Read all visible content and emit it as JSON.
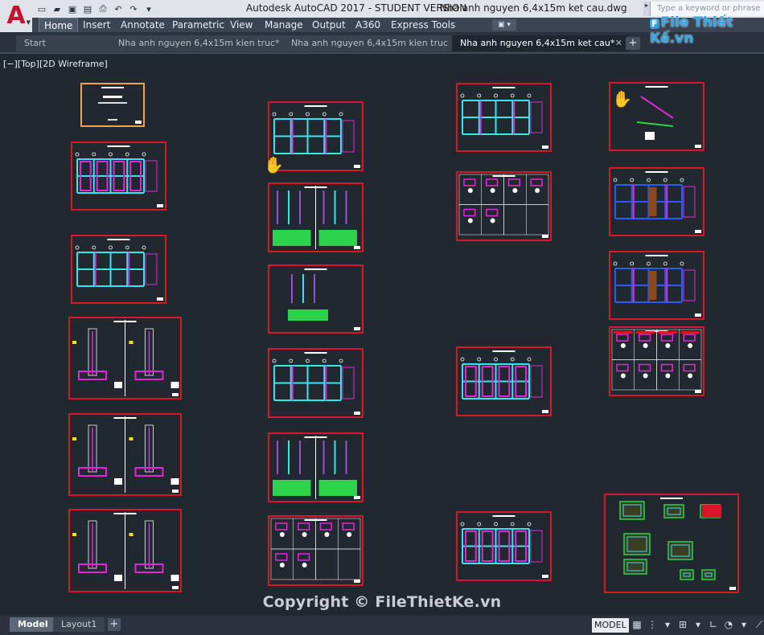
{
  "app": {
    "title": "Autodesk AutoCAD 2017 - STUDENT VERSION",
    "file": "Nha anh nguyen 6,4x15m ket cau.dwg",
    "logo_letter": "A",
    "search_placeholder": "Type a keyword or phrase"
  },
  "quick_access": [
    "new-icon",
    "open-icon",
    "save-icon",
    "saveas-icon",
    "print-icon",
    "undo-icon",
    "redo-icon",
    "more-icon"
  ],
  "ribbon": {
    "tabs": [
      "Home",
      "Insert",
      "Annotate",
      "Parametric",
      "View",
      "Manage",
      "Output",
      "A360",
      "Express Tools"
    ],
    "active": "Home",
    "extra_button": "▣ ▾"
  },
  "doc_tabs": [
    {
      "label": "Start",
      "active": false
    },
    {
      "label": "Nha anh nguyen 6,4x15m kien truc*",
      "active": false
    },
    {
      "label": "Nha anh nguyen 6,4x15m kien truc",
      "active": false
    },
    {
      "label": "Nha anh nguyen 6,4x15m ket cau*",
      "active": true
    }
  ],
  "viewport_label": "[−][Top][2D Wireframe]",
  "watermark": "Copyright © FileThietKe.vn",
  "logo_watermark": "File Thiết Kế.vn",
  "logo_prefix": "F",
  "status": {
    "layout_tabs": [
      "Model",
      "Layout1"
    ],
    "active_layout": "Model",
    "mode": "MODEL"
  },
  "colors": {
    "canvas": "#212830",
    "sheet_border": "#d9162a",
    "accent_cyan": "#39e3f0",
    "accent_magenta": "#e028d6",
    "accent_green": "#2bd24a"
  }
}
